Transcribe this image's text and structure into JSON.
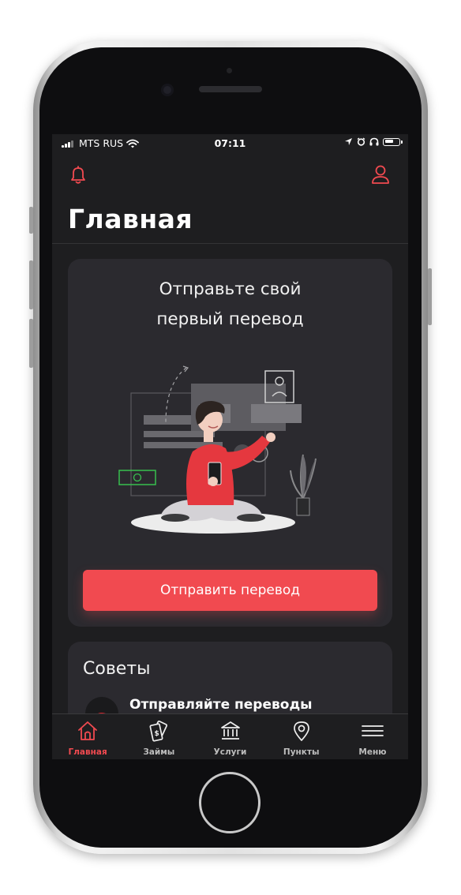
{
  "status_bar": {
    "carrier": "MTS RUS",
    "time": "07:11"
  },
  "header": {
    "title": "Главная"
  },
  "promo": {
    "title": "Отправьте свой\nпервый перевод",
    "button_label": "Отправить перевод"
  },
  "tips": {
    "title": "Советы",
    "first_tip": "Отправляйте переводы"
  },
  "tab_bar": {
    "items": [
      {
        "label": "Главная",
        "icon": "home-icon",
        "active": true
      },
      {
        "label": "Займы",
        "icon": "money-icon",
        "active": false
      },
      {
        "label": "Услуги",
        "icon": "bank-icon",
        "active": false
      },
      {
        "label": "Пункты",
        "icon": "location-icon",
        "active": false
      },
      {
        "label": "Меню",
        "icon": "menu-icon",
        "active": false
      }
    ]
  },
  "colors": {
    "accent": "#f14a50",
    "background": "#1e1e20",
    "card": "#2b2a2f"
  }
}
